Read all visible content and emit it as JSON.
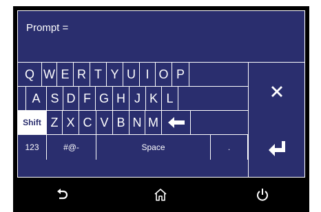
{
  "prompt": {
    "label": "Prompt ="
  },
  "keyboard": {
    "row1": [
      "Q",
      "W",
      "E",
      "R",
      "T",
      "Y",
      "U",
      "I",
      "O",
      "P"
    ],
    "row2": [
      "A",
      "S",
      "D",
      "F",
      "G",
      "H",
      "J",
      "K",
      "L"
    ],
    "row3": [
      "Shift",
      "Z",
      "X",
      "C",
      "V",
      "B",
      "N",
      "M"
    ],
    "row4": {
      "numbers": "123",
      "symbols": "#@-",
      "space": "Space",
      "period": "."
    }
  },
  "icons": {
    "backspace": "left-arrow-icon",
    "clear": "close-icon",
    "enter": "enter-icon",
    "back": "undo-back-icon",
    "home": "home-icon",
    "power": "power-icon"
  },
  "colors": {
    "panel": "#2a2e6e",
    "frame": "#000000",
    "text": "#ffffff"
  }
}
